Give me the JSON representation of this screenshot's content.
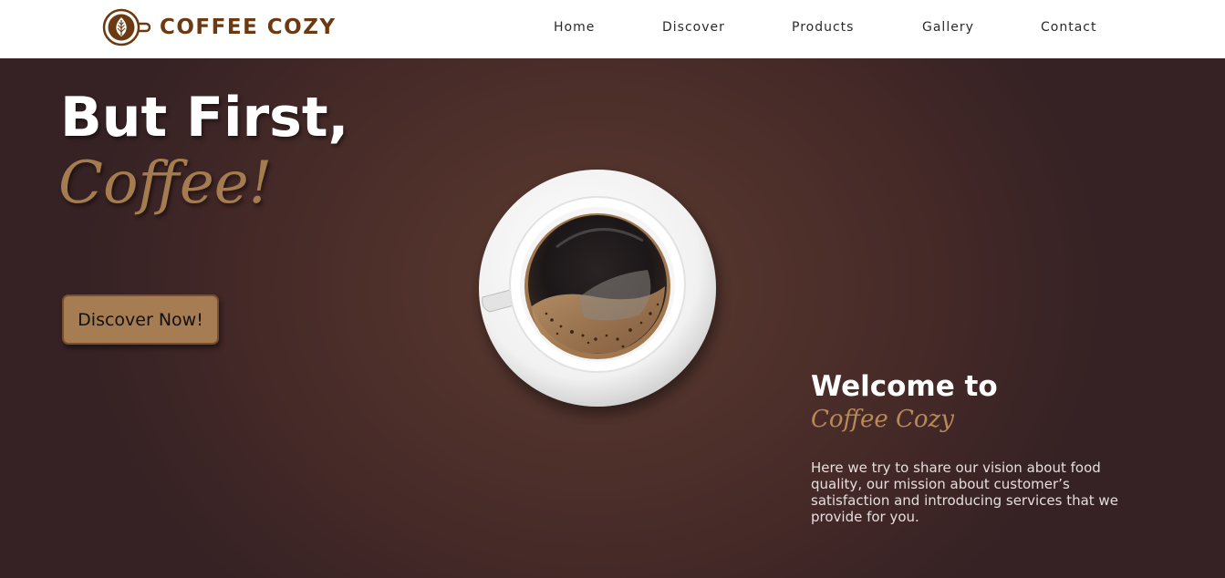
{
  "header": {
    "brand_name": "COFFEE COZY",
    "nav": [
      {
        "label": "Home"
      },
      {
        "label": "Discover"
      },
      {
        "label": "Products"
      },
      {
        "label": "Gallery"
      },
      {
        "label": "Contact"
      }
    ]
  },
  "hero": {
    "headline": "But First,",
    "script_word": "Coffee!",
    "cta_label": "Discover Now!"
  },
  "welcome": {
    "title": "Welcome to",
    "script_name": "Coffee Cozy",
    "description": "Here we try to share our vision about food quality, our mission about customer’s satisfaction and introducing services that we provide for you."
  },
  "colors": {
    "brand_brown": "#6b3a12",
    "accent_tan": "#a67c52",
    "hero_background": "#4a2e2b"
  },
  "icons": {
    "brand_logo": "latte-art-cup-icon",
    "hero_image": "coffee-cup-top-view"
  }
}
